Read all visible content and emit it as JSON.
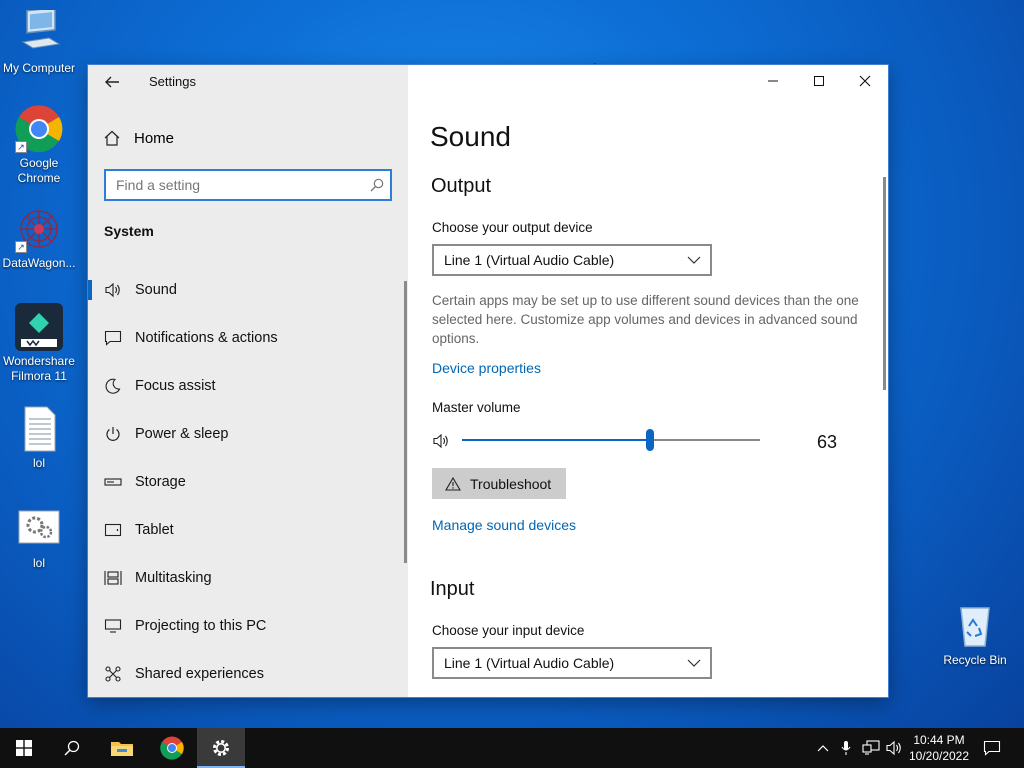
{
  "desktop": {
    "icons": [
      {
        "label": "My Computer",
        "icon": "computer-icon"
      },
      {
        "label": "Google Chrome",
        "icon": "chrome-icon"
      },
      {
        "label": "DataWagon...",
        "icon": "datawagon-icon"
      },
      {
        "label": "Wondershare Filmora 11",
        "icon": "filmora-icon"
      },
      {
        "label": "lol",
        "icon": "text-file-icon"
      },
      {
        "label": "lol",
        "icon": "settings-file-icon"
      },
      {
        "label": "Recycle Bin",
        "icon": "recycle-bin-icon"
      }
    ]
  },
  "window": {
    "title": "Settings",
    "nav": {
      "home_label": "Home",
      "search_placeholder": "Find a setting",
      "section_title": "System",
      "items": [
        {
          "label": "Sound",
          "icon": "speaker-icon",
          "selected": true
        },
        {
          "label": "Notifications & actions",
          "icon": "notifications-icon"
        },
        {
          "label": "Focus assist",
          "icon": "moon-icon"
        },
        {
          "label": "Power & sleep",
          "icon": "power-icon"
        },
        {
          "label": "Storage",
          "icon": "storage-icon"
        },
        {
          "label": "Tablet",
          "icon": "tablet-icon"
        },
        {
          "label": "Multitasking",
          "icon": "multitasking-icon"
        },
        {
          "label": "Projecting to this PC",
          "icon": "projecting-icon"
        },
        {
          "label": "Shared experiences",
          "icon": "shared-icon"
        }
      ]
    },
    "content": {
      "page_title": "Sound",
      "output": {
        "heading": "Output",
        "device_label": "Choose your output device",
        "device_value": "Line 1 (Virtual Audio Cable)",
        "description": "Certain apps may be set up to use different sound devices than the one selected here. Customize app volumes and devices in advanced sound options.",
        "device_properties_link": "Device properties",
        "master_volume_label": "Master volume",
        "volume_value": "63",
        "volume_percent": 63,
        "troubleshoot_label": "Troubleshoot",
        "manage_link": "Manage sound devices"
      },
      "input": {
        "heading": "Input",
        "device_label": "Choose your input device",
        "device_value": "Line 1 (Virtual Audio Cable)"
      }
    }
  },
  "taskbar": {
    "clock_time": "10:44 PM",
    "clock_date": "10/20/2022"
  },
  "colors": {
    "accent": "#0a66c2",
    "link": "#0066b4",
    "nav_background": "#ececec",
    "taskbar": "#101010"
  }
}
